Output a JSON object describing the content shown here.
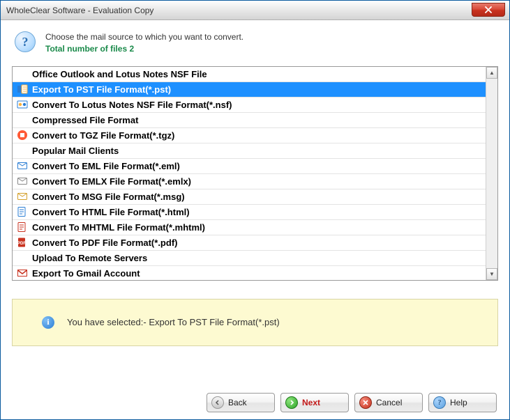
{
  "window": {
    "title": "WholeClear Software - Evaluation Copy"
  },
  "header": {
    "prompt": "Choose the mail source to which you want to convert.",
    "subline_prefix": "Total number of files ",
    "file_count": "2"
  },
  "groups": [
    {
      "title": "Office Outlook and Lotus Notes NSF File",
      "items": [
        {
          "id": "pst",
          "icon": "outlook-pst-icon",
          "label": "Export To PST File Format(*.pst)",
          "selected": true
        },
        {
          "id": "nsf",
          "icon": "lotus-nsf-icon",
          "label": "Convert To Lotus Notes NSF File Format(*.nsf)",
          "selected": false
        }
      ]
    },
    {
      "title": "Compressed File Format",
      "items": [
        {
          "id": "tgz",
          "icon": "tgz-icon",
          "label": "Convert to TGZ File Format(*.tgz)",
          "selected": false
        }
      ]
    },
    {
      "title": "Popular Mail Clients",
      "items": [
        {
          "id": "eml",
          "icon": "eml-icon",
          "label": "Convert To EML File Format(*.eml)",
          "selected": false
        },
        {
          "id": "emlx",
          "icon": "emlx-icon",
          "label": "Convert To EMLX File Format(*.emlx)",
          "selected": false
        },
        {
          "id": "msg",
          "icon": "msg-icon",
          "label": "Convert To MSG File Format(*.msg)",
          "selected": false
        },
        {
          "id": "html",
          "icon": "html-icon",
          "label": "Convert To HTML File Format(*.html)",
          "selected": false
        },
        {
          "id": "mhtml",
          "icon": "mhtml-icon",
          "label": "Convert To MHTML File Format(*.mhtml)",
          "selected": false
        },
        {
          "id": "pdf",
          "icon": "pdf-icon",
          "label": "Convert To PDF File Format(*.pdf)",
          "selected": false
        }
      ]
    },
    {
      "title": "Upload To Remote Servers",
      "items": [
        {
          "id": "gmail",
          "icon": "gmail-icon",
          "label": "Export To Gmail Account",
          "selected": false
        }
      ]
    }
  ],
  "info": {
    "prefix": "You have selected:- ",
    "selection": "Export To PST File Format(*.pst)"
  },
  "buttons": {
    "back": "Back",
    "next": "Next",
    "cancel": "Cancel",
    "help": "Help"
  }
}
